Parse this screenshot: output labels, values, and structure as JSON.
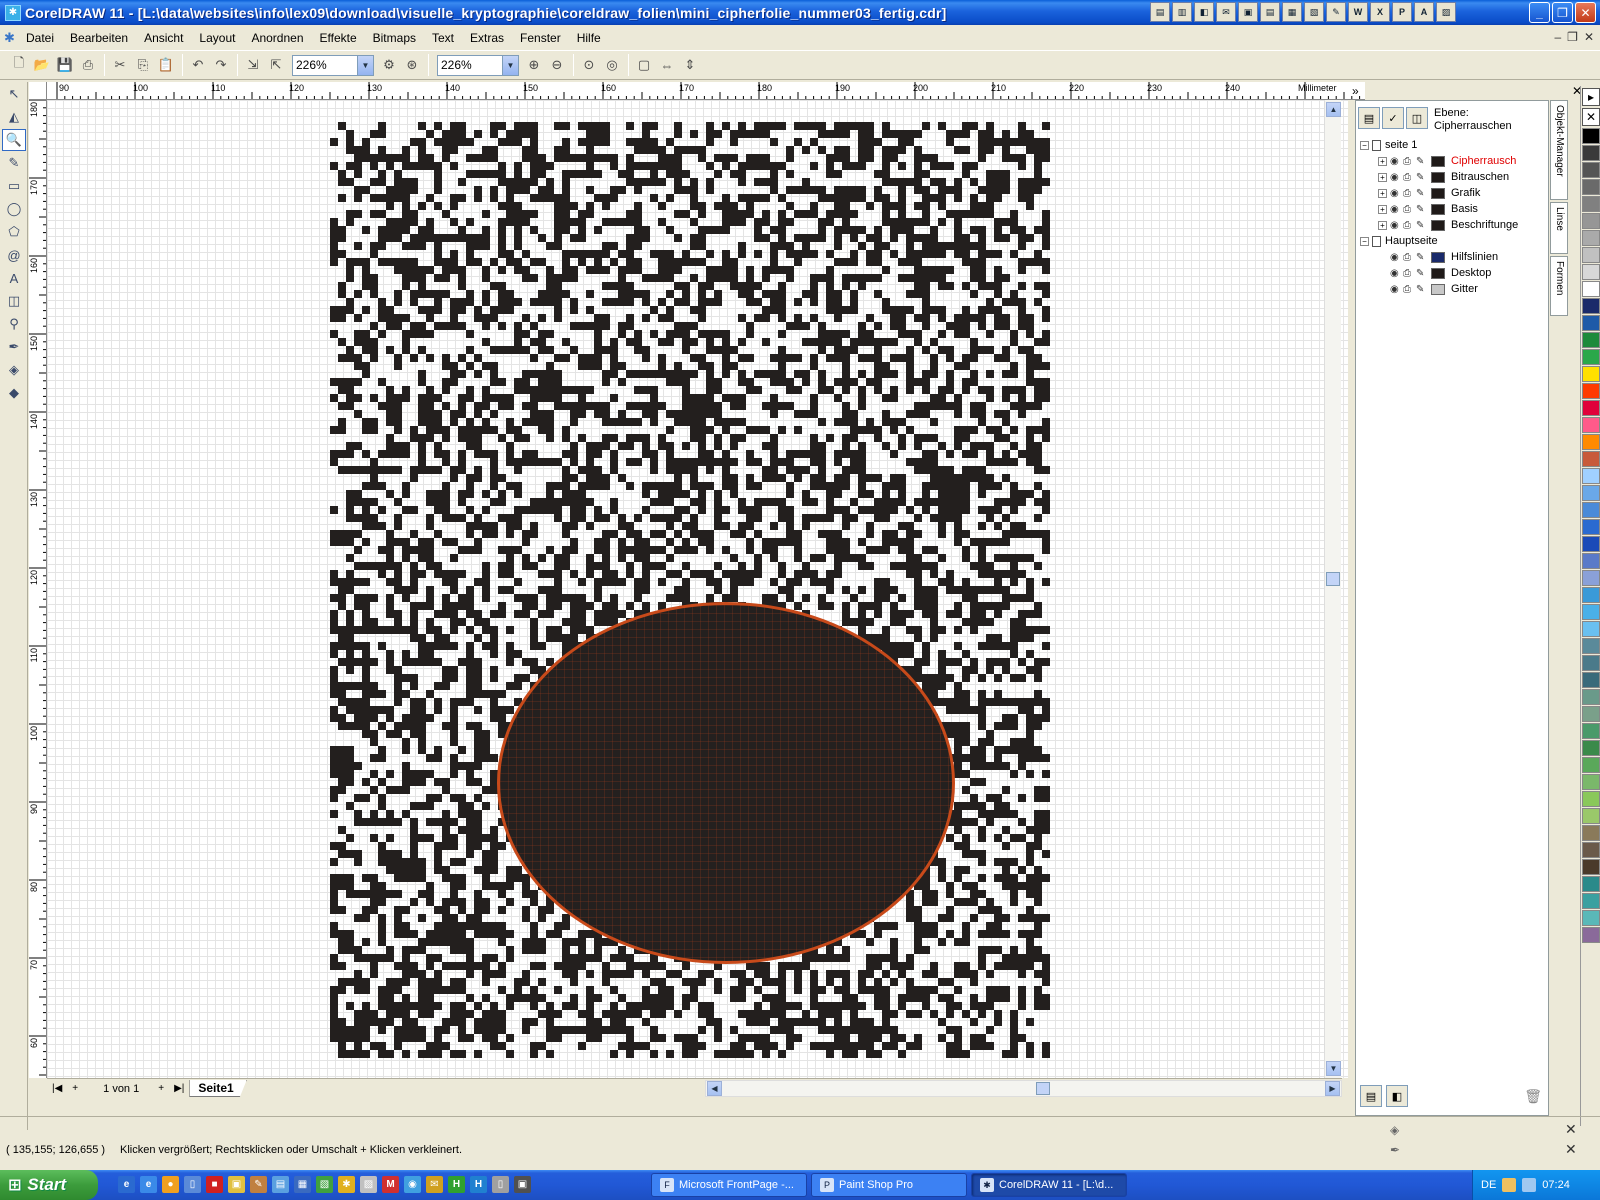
{
  "window": {
    "title": "CorelDRAW 11 - [L:\\data\\websites\\info\\lex09\\download\\visuelle_kryptographie\\coreldraw_folien\\mini_cipherfolie_nummer03_fertig.cdr]",
    "buttons": [
      "_",
      "❐",
      "✕"
    ]
  },
  "menubar": {
    "items": [
      "Datei",
      "Bearbeiten",
      "Ansicht",
      "Layout",
      "Anordnen",
      "Effekte",
      "Bitmaps",
      "Text",
      "Extras",
      "Fenster",
      "Hilfe"
    ]
  },
  "toolbar": {
    "zoom_value": "226%",
    "zoom_value_2": "226%"
  },
  "ruler": {
    "unit": "Millimeter",
    "top_labels": [
      "90",
      "100",
      "110",
      "120",
      "130",
      "140",
      "150",
      "160",
      "170",
      "180",
      "190",
      "200",
      "210",
      "220",
      "230",
      "240"
    ],
    "left_labels": [
      "180",
      "170",
      "160",
      "150",
      "140",
      "130",
      "120",
      "110",
      "100",
      "90",
      "80",
      "70",
      "60"
    ]
  },
  "pagebar": {
    "page_count": "1 von 1",
    "page_tab": "Seite1"
  },
  "docker": {
    "layer_caption": "Ebene:",
    "layer_name": "Cipherrauschen",
    "tree": {
      "page1": "seite 1",
      "layers": [
        {
          "name": "Cipherrausch",
          "color": "#1f1a18",
          "active": true
        },
        {
          "name": "Bitrauschen",
          "color": "#1f1a18",
          "active": false
        },
        {
          "name": "Grafik",
          "color": "#1f1a18",
          "active": false
        },
        {
          "name": "Basis",
          "color": "#1f1a18",
          "active": false
        },
        {
          "name": "Beschriftunge",
          "color": "#1f1a18",
          "active": false
        }
      ],
      "master": "Hauptseite",
      "master_layers": [
        {
          "name": "Hilfslinien",
          "color": "#1a2a6a"
        },
        {
          "name": "Desktop",
          "color": "#1f1a18"
        },
        {
          "name": "Gitter",
          "color": "#c8c8c8"
        }
      ]
    },
    "tabs": [
      "Objekt-Manager",
      "Linse",
      "Formen"
    ]
  },
  "palette": [
    "#000000",
    "#3a3a3a",
    "#555555",
    "#6a6a6a",
    "#808080",
    "#969696",
    "#aaaaaa",
    "#c0c0c0",
    "#d8d8d8",
    "#ffffff",
    "#1a2a6a",
    "#1e5aa8",
    "#1e8a3a",
    "#2aa84a",
    "#ffe000",
    "#ff3a00",
    "#e0003a",
    "#ff5a8a",
    "#ff8a00",
    "#c85a3a",
    "#a0d0ff",
    "#6aa8e8",
    "#4a8ad8",
    "#2a6ad0",
    "#1a4ab8",
    "#5a7ac8",
    "#8aa0d8",
    "#3a9ad8",
    "#4ab0e8",
    "#6ac0f0",
    "#5a8a9a",
    "#4a7a8a",
    "#3a6a7a",
    "#6a9a8a",
    "#7aa08a",
    "#4a9a6a",
    "#3a8a4a",
    "#5aa85a",
    "#7ab86a",
    "#8ac85a",
    "#9ac86a",
    "#8a7a5a",
    "#6a5a4a",
    "#4a3a2a",
    "#2a8a8a",
    "#3aa0a0",
    "#5ab8b8",
    "#8a6a9a"
  ],
  "status": {
    "coords": "( 135,155; 126,655 )",
    "hint": "Klicken vergrößert; Rechtsklicken oder Umschalt + Klicken verkleinert."
  },
  "taskbar": {
    "start": "Start",
    "tasks": [
      "Microsoft FrontPage -...",
      "Paint Shop Pro",
      "CorelDRAW 11 - [L:\\d..."
    ],
    "lang": "DE",
    "clock": "07:24"
  },
  "colors": {
    "noise": "#231f1e",
    "ellipse_fill": "#24201f",
    "ellipse_outline": "#c84a1a"
  }
}
